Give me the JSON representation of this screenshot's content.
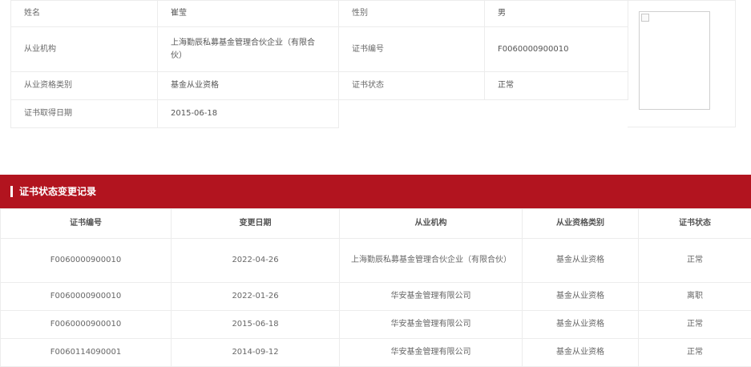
{
  "info": {
    "name_label": "姓名",
    "name_value": "崔莹",
    "gender_label": "性别",
    "gender_value": "男",
    "org_label": "从业机构",
    "org_value": "上海勤辰私募基金管理合伙企业（有限合伙）",
    "cert_no_label": "证书编号",
    "cert_no_value": "F0060000900010",
    "qual_label": "从业资格类别",
    "qual_value": "基金从业资格",
    "status_label": "证书状态",
    "status_value": "正常",
    "date_label": "证书取得日期",
    "date_value": "2015-06-18"
  },
  "records_section": {
    "title": "证书状态变更记录",
    "columns": [
      "证书编号",
      "变更日期",
      "从业机构",
      "从业资格类别",
      "证书状态"
    ],
    "rows": [
      [
        "F0060000900010",
        "2022-04-26",
        "上海勤辰私募基金管理合伙企业（有限合伙）",
        "基金从业资格",
        "正常"
      ],
      [
        "F0060000900010",
        "2022-01-26",
        "华安基金管理有限公司",
        "基金从业资格",
        "离职"
      ],
      [
        "F0060000900010",
        "2015-06-18",
        "华安基金管理有限公司",
        "基金从业资格",
        "正常"
      ],
      [
        "F0060114090001",
        "2014-09-12",
        "华安基金管理有限公司",
        "基金从业资格",
        "正常"
      ]
    ]
  },
  "colors": {
    "header_red": "#b2141f",
    "border": "#ececec"
  }
}
